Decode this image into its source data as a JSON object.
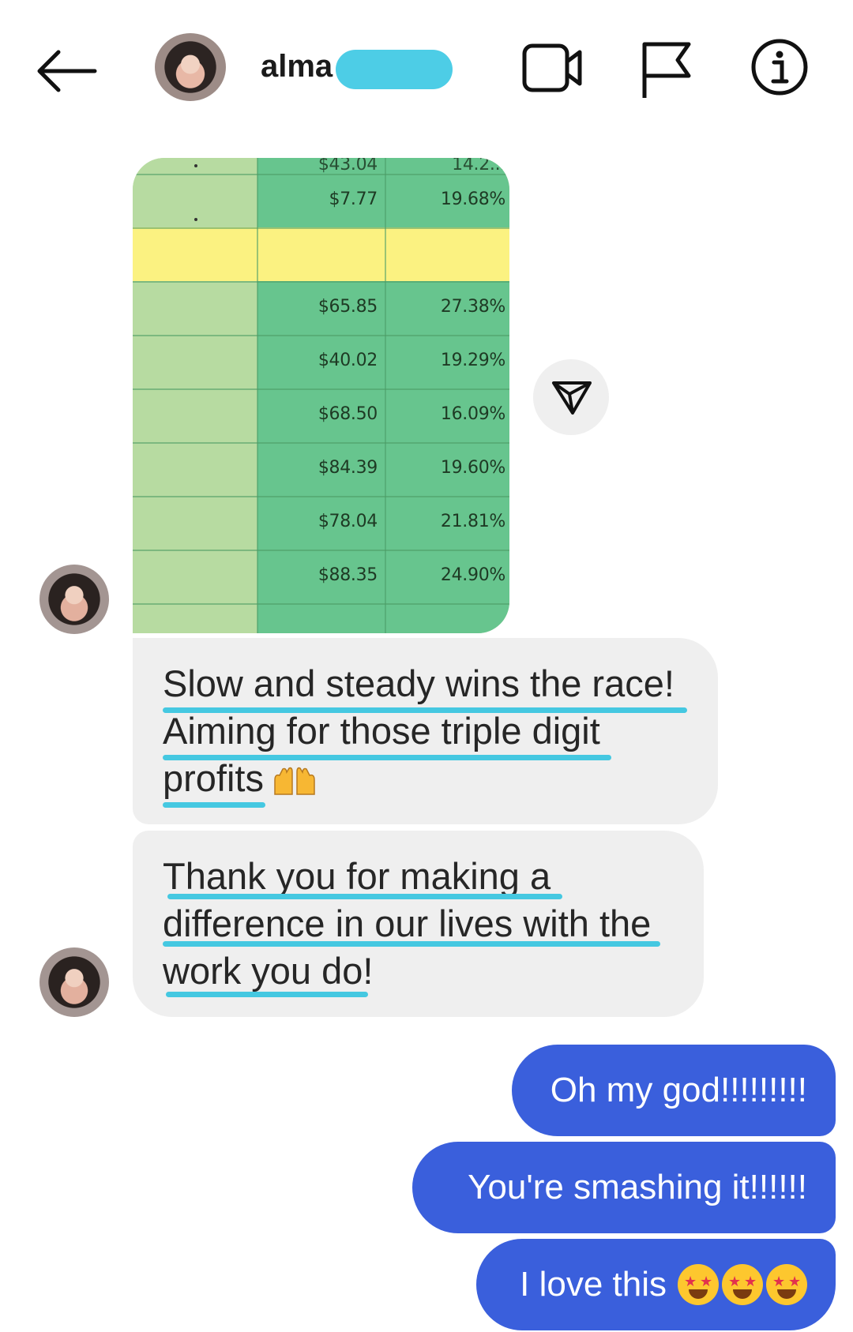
{
  "header": {
    "contact_name": "alma",
    "back_icon": "arrow-left-icon",
    "video_icon": "video-camera-icon",
    "flag_icon": "flag-icon",
    "info_icon": "info-icon"
  },
  "shared_image": {
    "partial_top_row": [
      "$43.04",
      "14.2..."
    ],
    "rows": [
      {
        "amount": "$7.77",
        "percent": "19.68%"
      },
      {
        "amount": "$65.85",
        "percent": "27.38%"
      },
      {
        "amount": "$40.02",
        "percent": "19.29%"
      },
      {
        "amount": "$68.50",
        "percent": "16.09%"
      },
      {
        "amount": "$84.39",
        "percent": "19.60%"
      },
      {
        "amount": "$78.04",
        "percent": "21.81%"
      },
      {
        "amount": "$88.35",
        "percent": "24.90%"
      }
    ],
    "share_icon": "send-paper-plane-icon"
  },
  "messages": {
    "received": [
      {
        "lines": [
          "Slow and steady wins the race!",
          "Aiming for those triple digit",
          "profits"
        ],
        "emoji": "raising-hands-emoji"
      },
      {
        "lines": [
          "Thank you for making a",
          "difference in our lives with the",
          "work you do!"
        ]
      }
    ],
    "sent": [
      {
        "text": "Oh my god!!!!!!!!!"
      },
      {
        "text": "You're smashing it!!!!!!"
      },
      {
        "text": "I love this",
        "emoji": "star-struck-emoji"
      }
    ]
  },
  "colors": {
    "sent_bubble": "#3a5fdc",
    "received_bubble": "#efefef",
    "underline_highlight": "#45c8e1",
    "sheet_green": "#67c58e",
    "sheet_yellow": "#fbf281"
  }
}
